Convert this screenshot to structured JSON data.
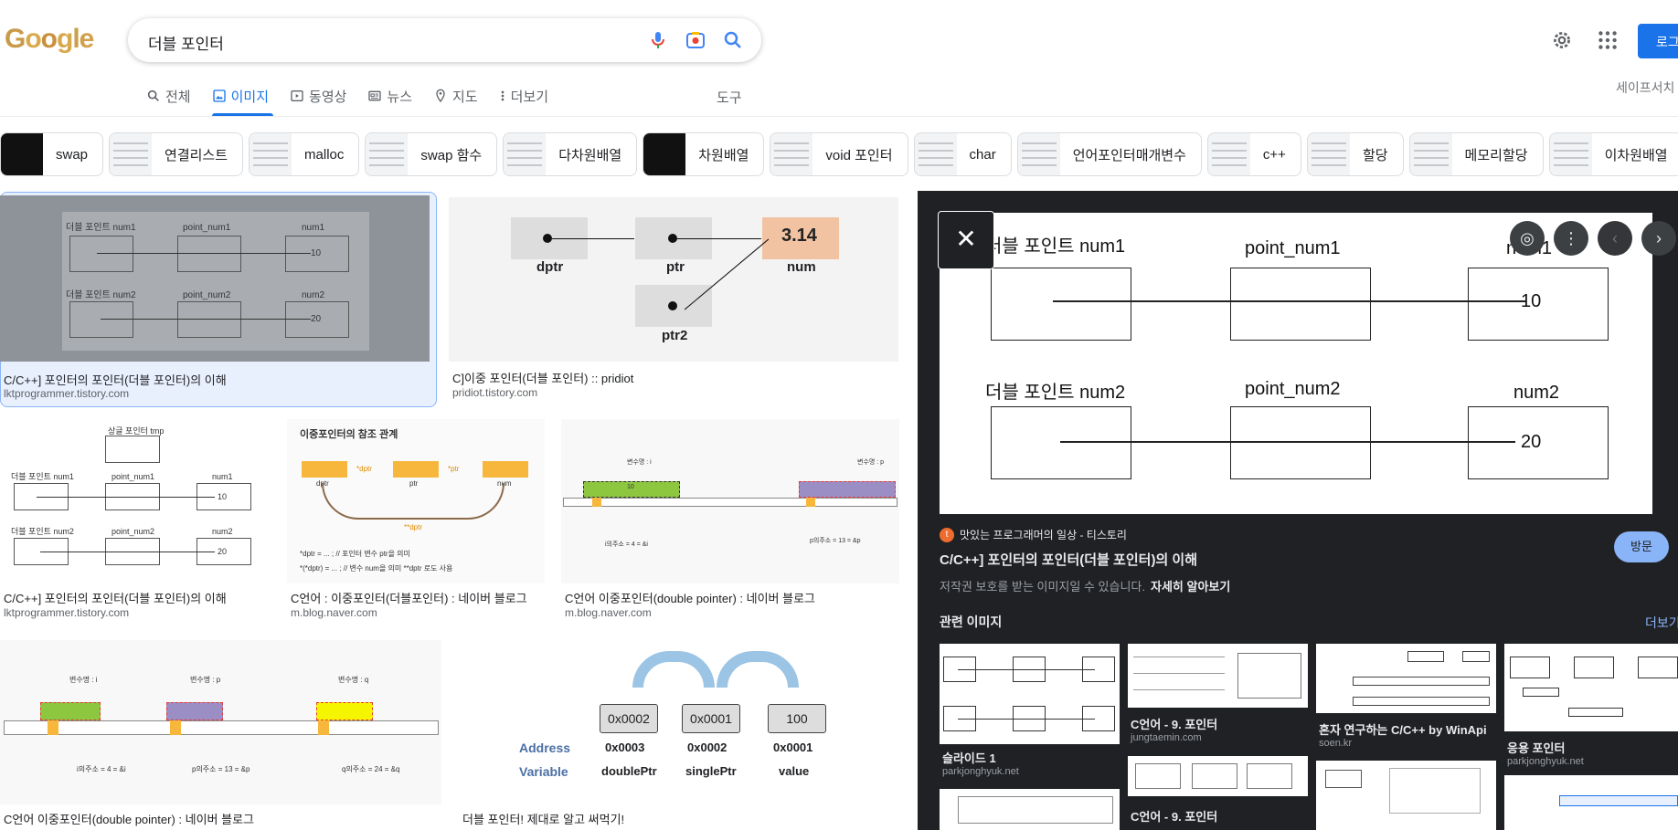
{
  "header": {
    "logo_letters": [
      "G",
      "o",
      "o",
      "g",
      "l",
      "e"
    ],
    "query": "더블 포인터",
    "login_label": "로그",
    "safesearch": "세이프서치"
  },
  "tabs": [
    {
      "label": "전체",
      "icon": "search-icon"
    },
    {
      "label": "이미지",
      "icon": "image-icon",
      "active": true
    },
    {
      "label": "동영상",
      "icon": "video-icon"
    },
    {
      "label": "뉴스",
      "icon": "news-icon"
    },
    {
      "label": "지도",
      "icon": "map-pin-icon"
    },
    {
      "label": "더보기",
      "icon": "more-vert-icon"
    }
  ],
  "tools_label": "도구",
  "chips": [
    {
      "label": "swap",
      "dark": true
    },
    {
      "label": "연결리스트",
      "dark": false
    },
    {
      "label": "malloc",
      "dark": false
    },
    {
      "label": "swap 함수",
      "dark": false
    },
    {
      "label": "다차원배열",
      "dark": false
    },
    {
      "label": "차원배열",
      "dark": true
    },
    {
      "label": "void 포인터",
      "dark": false
    },
    {
      "label": "char",
      "dark": false
    },
    {
      "label": "언어포인터매개변수",
      "dark": false
    },
    {
      "label": "c++",
      "dark": false
    },
    {
      "label": "할당",
      "dark": false
    },
    {
      "label": "메모리할당",
      "dark": false
    },
    {
      "label": "이차원배열",
      "dark": false
    }
  ],
  "results": [
    {
      "title": "C/C++] 포인터의 포인터(더블 포인터)의 이해",
      "source": "lktprogrammer.tistory.com"
    },
    {
      "title": "C]이중 포인터(더블 포인터) :: pridiot",
      "source": "pridiot.tistory.com"
    },
    {
      "title": "C/C++] 포인터의 포인터(더블 포인터)의 이해",
      "source": "lktprogrammer.tistory.com"
    },
    {
      "title": "C언어 : 이중포인터(더블포인터) : 네이버 블로그",
      "source": "m.blog.naver.com"
    },
    {
      "title": "C언어 이중포인터(double pointer) : 네이버 블로그",
      "source": "m.blog.naver.com"
    },
    {
      "title": "C언어 이중포인터(double pointer) : 네이버 블로그",
      "source": ""
    },
    {
      "title": "더블 포인터! 제대로 알고 써먹기!",
      "source": ""
    }
  ],
  "diagram": {
    "row1_left": "더블 포인트 num1",
    "row1_mid": "point_num1",
    "row1_right": "num1",
    "row1_value": "10",
    "row2_left": "더블 포인트 num2",
    "row2_mid": "point_num2",
    "row2_right": "num2",
    "row2_value": "20"
  },
  "ptr_diagram": {
    "a": "dptr",
    "b": "ptr",
    "c": "num",
    "d": "ptr2",
    "value": "3.14"
  },
  "diagram3": {
    "top": "상글 포인터 tmp"
  },
  "diagram4": {
    "title": "이중포인터의 참조 관계",
    "n1": "dptr",
    "n2": "ptr",
    "n3": "num",
    "e1": "*dptr",
    "e2": "*ptr",
    "e3": "**dptr",
    "line1": "*dptr = ... ;       // 포인터 변수 ptr을 의미",
    "line2": "*(*dptr) = ... ;    // 변수 num을 의미 **dptr 로도 사용"
  },
  "diagram5": {
    "var_i": "변수명 : i",
    "var_p": "변수명 : p",
    "val": "10",
    "addr_i": "i의주소 = 4 = &i",
    "addr_p": "p의주소 = 13 = &p"
  },
  "diagram6": {
    "var_i": "변수명 : i",
    "var_p": "변수명 : p",
    "var_q": "변수명 : q",
    "addr_i": "i의주소 = 4 = &i",
    "addr_p": "p의주소 = 13 = &p",
    "addr_q": "q의주소 = 24 = &q"
  },
  "diagram7": {
    "addr_label": "Address",
    "var_label": "Variable",
    "v1": "0x0002",
    "v2": "0x0001",
    "v3": "100",
    "a1": "0x0003",
    "a2": "0x0002",
    "a3": "0x0001",
    "n1": "doublePtr",
    "n2": "singlePtr",
    "n3": "value"
  },
  "preview": {
    "site": "맛있는 프로그래머의 일상 - 티스토리",
    "title": "C/C++] 포인터의 포인터(더블 포인터)의 이해",
    "copyright": "저작권 보호를 받는 이미지일 수 있습니다.",
    "learn_more": "자세히 알아보기",
    "visit": "방문",
    "related_heading": "관련 이미지",
    "more": "더보기"
  },
  "related": [
    {
      "title": "슬라이드 1",
      "source": "parkjonghyuk.net"
    },
    {
      "title": "C언어 - 9. 포인터",
      "source": "jungtaemin.com"
    },
    {
      "title": "혼자 연구하는 C/C++ by WinApi",
      "source": "soen.kr"
    },
    {
      "title": "응용 포인터",
      "source": "parkjonghyuk.net"
    },
    {
      "title": "C언어 - 9. 포인터",
      "source": ""
    }
  ],
  "colors": {
    "accent": "#1a73e8",
    "panel_bg": "#202124",
    "link_dark": "#8ab4f8"
  }
}
